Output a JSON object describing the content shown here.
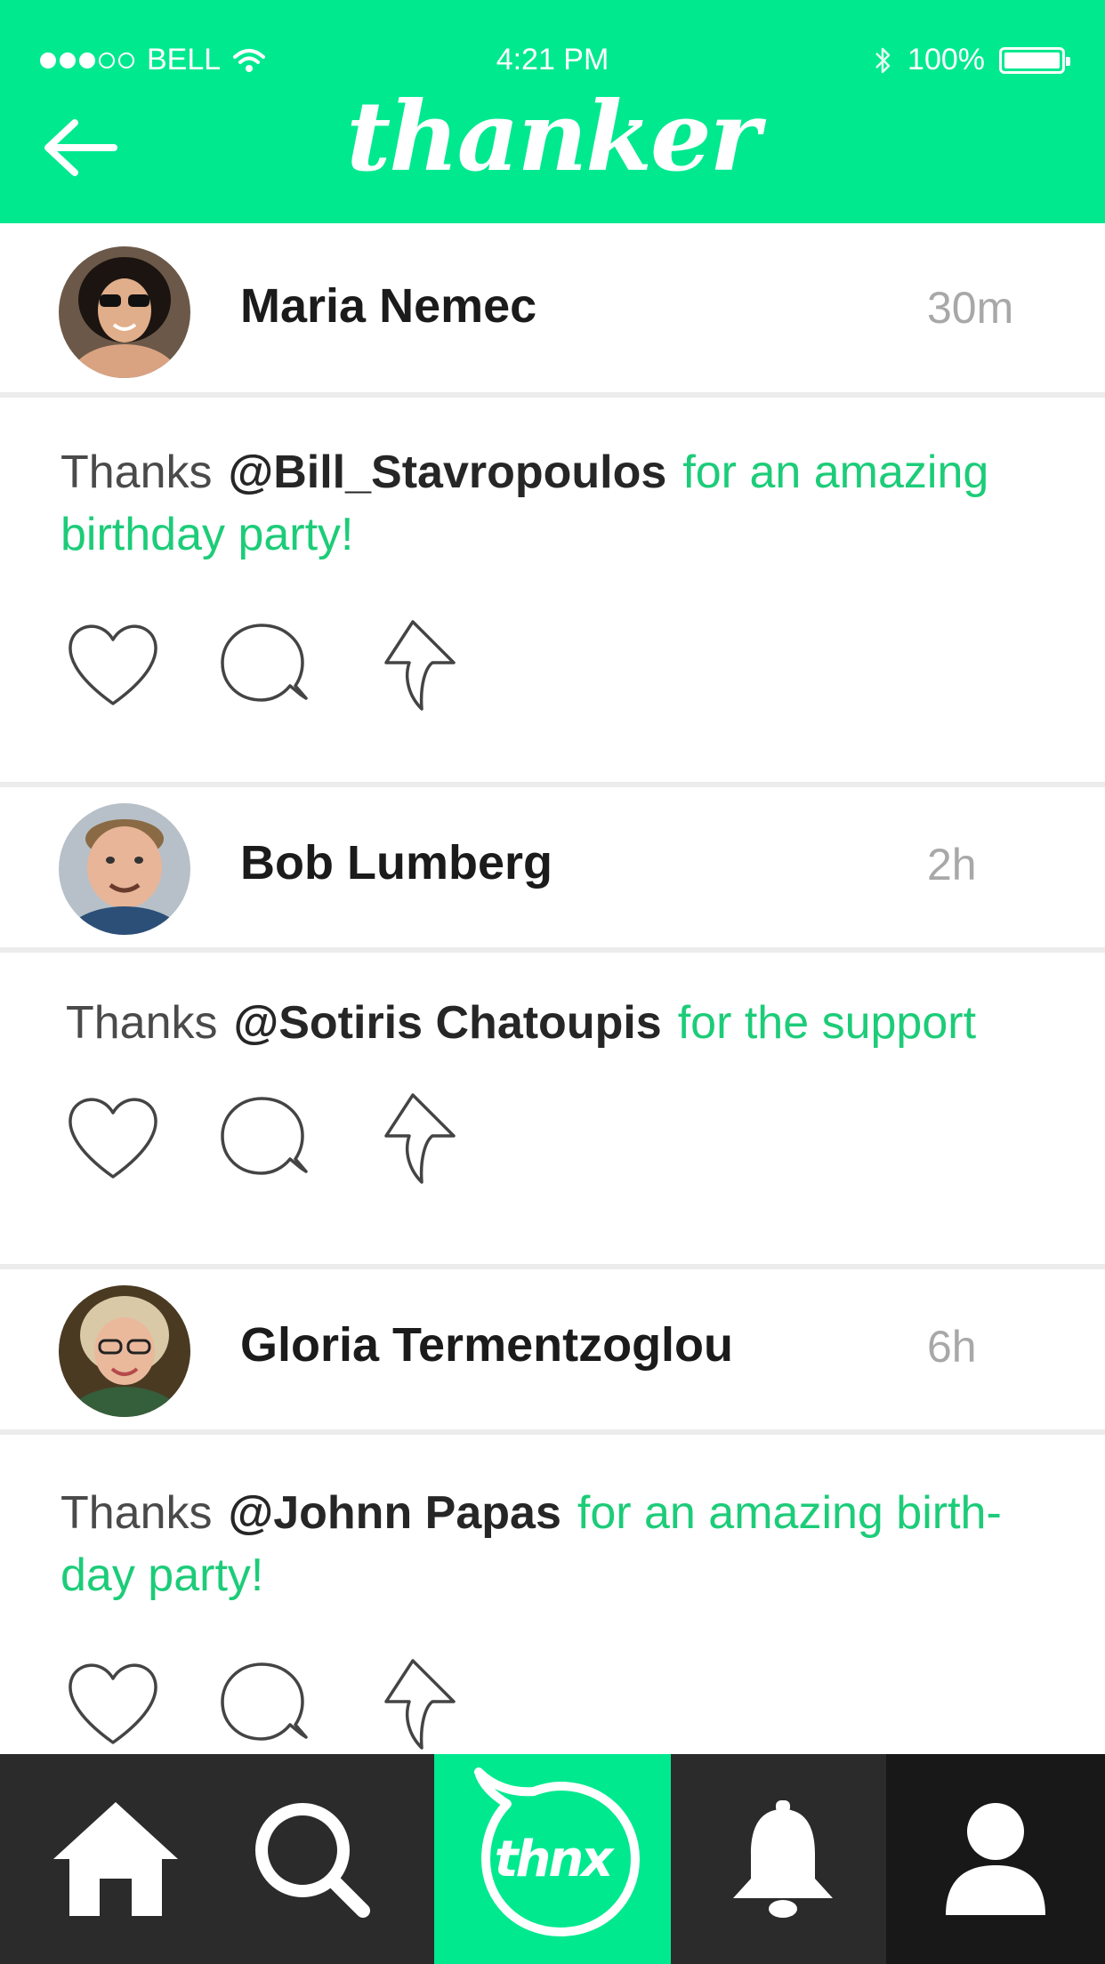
{
  "status_bar": {
    "carrier": "BELL",
    "time": "4:21 PM",
    "battery": "100%",
    "signal_filled": 3,
    "signal_empty": 2
  },
  "header": {
    "logo": "thanker",
    "back_icon": "arrow-left-icon",
    "color": "#00e98f"
  },
  "feed": [
    {
      "user": "Maria Nemec",
      "time": "30m",
      "thanks": "Thanks",
      "mention": "@Bill_Stavropoulos",
      "message": "for an amazing birthday party!"
    },
    {
      "user": "Bob Lumberg",
      "time": "2h",
      "thanks": "Thanks",
      "mention": "@Sotiris Chatoupis",
      "message": "for the support"
    },
    {
      "user": "Gloria Termentzoglou",
      "time": "6h",
      "thanks": "Thanks",
      "mention": "@Johnn Papas",
      "message": "for an amazing birth-day party!"
    }
  ],
  "tabbar": {
    "thnx_label": "thnx",
    "active_color": "#00e98f",
    "tabs": [
      "home-icon",
      "search-icon",
      "thnx-icon",
      "bell-icon",
      "profile-icon"
    ]
  },
  "colors": {
    "accent": "#00e98f",
    "message_green": "#1ccc78",
    "tabbar_bg": "#2b2b2b"
  }
}
